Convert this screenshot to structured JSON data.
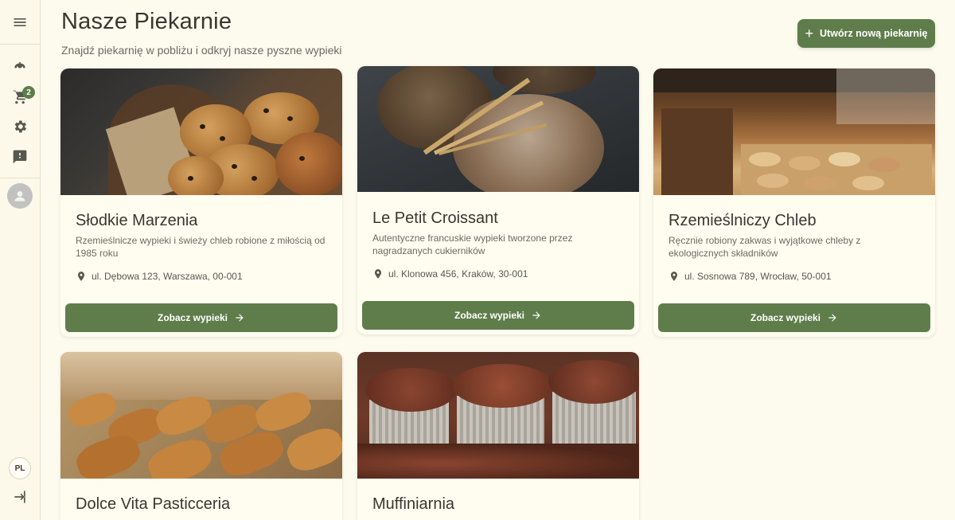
{
  "sidebar": {
    "cart_count": "2",
    "language": "PL"
  },
  "header": {
    "title": "Nasze Piekarnie",
    "subtitle": "Znajdź piekarnię w pobliżu i odkryj nasze pyszne wypieki",
    "create_label": "Utwórz nową piekarnię"
  },
  "bakeries": [
    {
      "name": "Słodkie Marzenia",
      "description": "Rzemieślnicze wypieki i świeży chleb robione z miłością od 1985 roku",
      "address": "ul. Dębowa 123, Warszawa, 00-001",
      "button": "Zobacz wypieki"
    },
    {
      "name": "Le Petit Croissant",
      "description": "Autentyczne francuskie wypieki tworzone przez nagradzanych cukierników",
      "address": "ul. Klonowa 456, Kraków, 30-001",
      "button": "Zobacz wypieki"
    },
    {
      "name": "Rzemieślniczy Chleb",
      "description": "Ręcznie robiony zakwas i wyjątkowe chleby z ekologicznych składników",
      "address": "ul. Sosnowa 789, Wrocław, 50-001",
      "button": "Zobacz wypieki"
    },
    {
      "name": "Dolce Vita Pasticceria"
    },
    {
      "name": "Muffiniarnia"
    }
  ]
}
